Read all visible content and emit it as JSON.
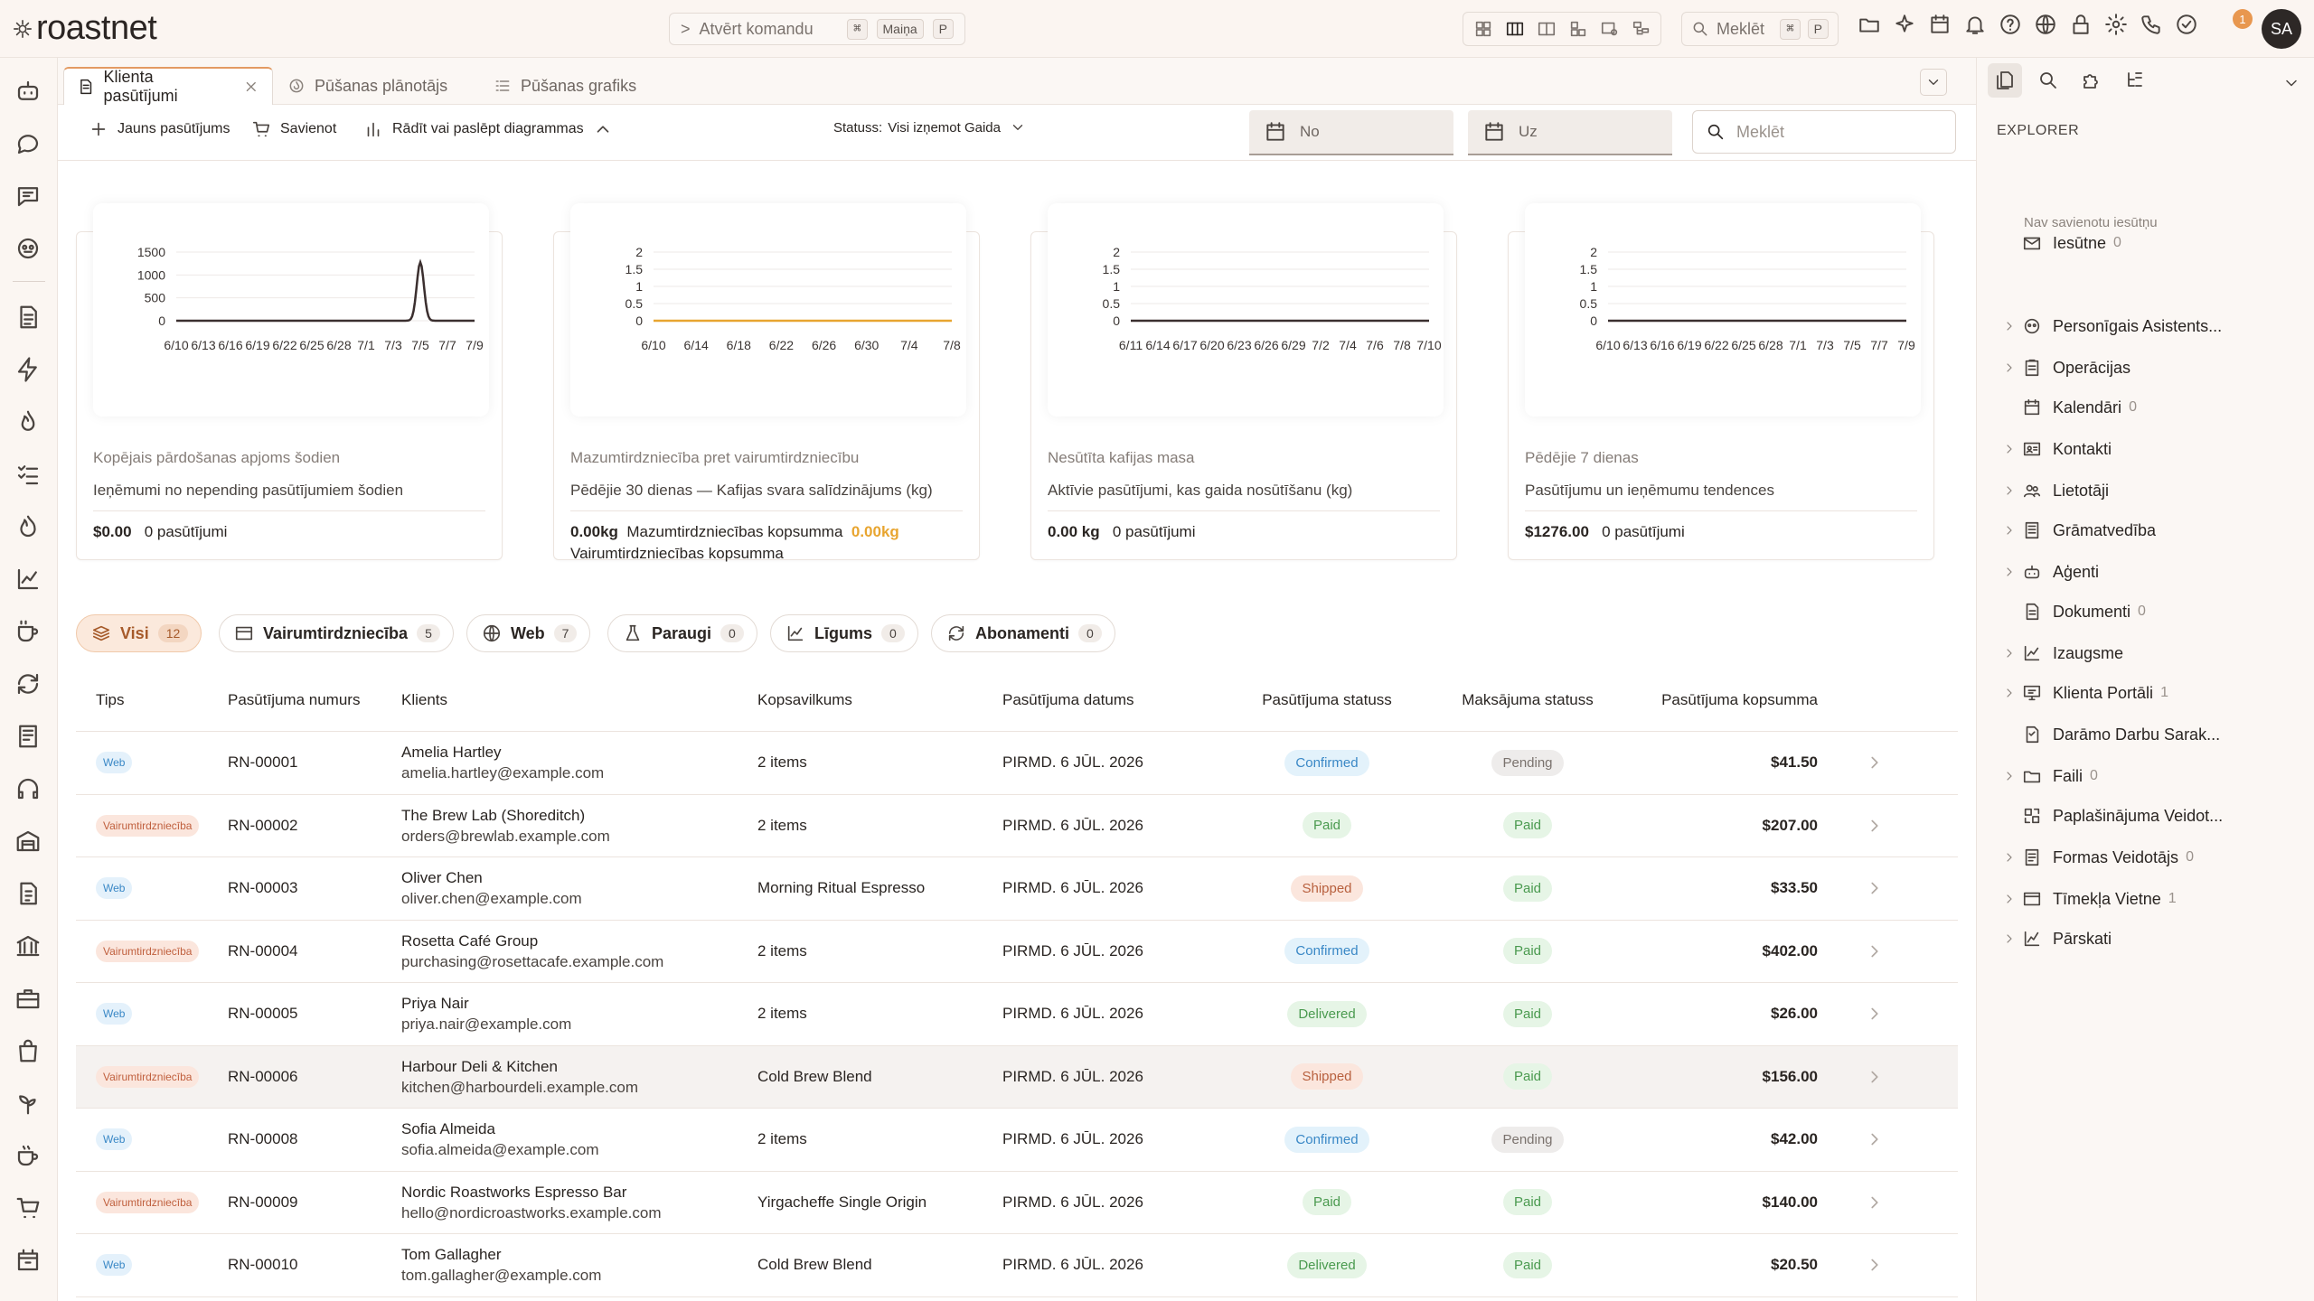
{
  "app": {
    "name": "roastnet",
    "user_initials": "SA",
    "notifications": "1"
  },
  "command": {
    "label": "Atvērt komandu",
    "key1": "⌘",
    "key2": "Maiņa",
    "key3": "P"
  },
  "global_search": {
    "label": "Meklēt",
    "key1": "⌘",
    "key2": "P"
  },
  "tabs": [
    {
      "label": "Klienta pasūtījumi"
    },
    {
      "label": "Pūšanas plānotājs"
    },
    {
      "label": "Pūšanas grafiks"
    }
  ],
  "toolbar": {
    "new_order": "Jauns pasūtījums",
    "connect": "Savienot",
    "toggle_charts": "Rādīt vai paslēpt diagrammas",
    "status_label": "Statuss:",
    "status_value": "Visi izņemot Gaida",
    "date_from": "No",
    "date_to": "Uz",
    "search_placeholder": "Meklēt"
  },
  "cards": [
    {
      "title": "Kopējais pārdošanas apjoms šodien",
      "subtitle": "Ieņēmumi no nepending pasūtījumiem šodien",
      "value": "$0.00",
      "count": "0 pasūtījumi"
    },
    {
      "title": "Mazumtirdzniecība pret vairumtirdzniecību",
      "subtitle": "Pēdējie 30 dienas — Kafijas svara salīdzinājums (kg)",
      "value": "0.00kg",
      "value_label": "Mazumtirdzniecības kopsumma",
      "value2": "0.00kg",
      "value2_label": "Vairumtirdzniecības kopsumma"
    },
    {
      "title": "Nesūtīta kafijas masa",
      "subtitle": "Aktīvie pasūtījumi, kas gaida nosūtīšanu (kg)",
      "value": "0.00 kg",
      "count": "0 pasūtījumi"
    },
    {
      "title": "Pēdējie 7 dienas",
      "subtitle": "Pasūtījumu un ieņēmumu tendences",
      "value": "$1276.00",
      "count": "0 pasūtījumi"
    }
  ],
  "chart_data": [
    {
      "type": "line",
      "x": [
        "6/10",
        "6/13",
        "6/16",
        "6/19",
        "6/22",
        "6/25",
        "6/28",
        "7/1",
        "7/3",
        "7/5",
        "7/7",
        "7/9"
      ],
      "yticks": [
        0,
        500,
        1000,
        1500
      ],
      "ylim": [
        0,
        1500
      ],
      "series": [
        {
          "color": "#3b2f2f",
          "values": [
            0,
            0,
            0,
            0,
            0,
            0,
            0,
            0,
            0,
            1276,
            0,
            0
          ]
        }
      ]
    },
    {
      "type": "line",
      "x": [
        "6/10",
        "6/14",
        "6/18",
        "6/22",
        "6/26",
        "6/30",
        "7/4",
        "7/8"
      ],
      "yticks": [
        0,
        0.5,
        1,
        1.5,
        2
      ],
      "ylim": [
        0,
        2
      ],
      "series": [
        {
          "color": "#e8a530",
          "values": [
            0,
            0,
            0,
            0,
            0,
            0,
            0,
            0
          ]
        }
      ]
    },
    {
      "type": "line",
      "x": [
        "6/11",
        "6/14",
        "6/17",
        "6/20",
        "6/23",
        "6/26",
        "6/29",
        "7/2",
        "7/4",
        "7/6",
        "7/8",
        "7/10"
      ],
      "yticks": [
        0,
        0.5,
        1,
        1.5,
        2
      ],
      "ylim": [
        0,
        2
      ],
      "series": [
        {
          "color": "#3b2f2f",
          "values": [
            0,
            0,
            0,
            0,
            0,
            0,
            0,
            0,
            0,
            0,
            0,
            0
          ]
        }
      ]
    },
    {
      "type": "line",
      "x": [
        "6/10",
        "6/13",
        "6/16",
        "6/19",
        "6/22",
        "6/25",
        "6/28",
        "7/1",
        "7/3",
        "7/5",
        "7/7",
        "7/9"
      ],
      "yticks": [
        0,
        0.5,
        1,
        1.5,
        2
      ],
      "ylim": [
        0,
        2
      ],
      "series": [
        {
          "color": "#3b2f2f",
          "values": [
            0,
            0,
            0,
            0,
            0,
            0,
            0,
            0,
            0,
            0,
            0,
            0
          ]
        }
      ]
    }
  ],
  "filters": [
    {
      "label": "Visi",
      "count": "12"
    },
    {
      "label": "Vairumtirdzniecība",
      "count": "5"
    },
    {
      "label": "Web",
      "count": "7"
    },
    {
      "label": "Paraugi",
      "count": "0"
    },
    {
      "label": "Līgums",
      "count": "0"
    },
    {
      "label": "Abonamenti",
      "count": "0"
    }
  ],
  "table": {
    "headers": [
      "Tips",
      "Pasūtījuma numurs",
      "Klients",
      "Kopsavilkums",
      "Pasūtījuma datums",
      "Pasūtījuma statuss",
      "Maksājuma statuss",
      "Pasūtījuma kopsumma"
    ],
    "rows": [
      {
        "type": "Web",
        "num": "RN-00001",
        "name": "Amelia Hartley",
        "email": "amelia.hartley@example.com",
        "summary": "2 items",
        "date": "PIRMD. 6 JŪL. 2026",
        "status": "Confirmed",
        "payment": "Pending",
        "total": "$41.50"
      },
      {
        "type": "Vairumtirdzniecība",
        "num": "RN-00002",
        "name": "The Brew Lab (Shoreditch)",
        "email": "orders@brewlab.example.com",
        "summary": "2 items",
        "date": "PIRMD. 6 JŪL. 2026",
        "status": "Paid",
        "payment": "Paid",
        "total": "$207.00"
      },
      {
        "type": "Web",
        "num": "RN-00003",
        "name": "Oliver Chen",
        "email": "oliver.chen@example.com",
        "summary": "Morning Ritual Espresso",
        "date": "PIRMD. 6 JŪL. 2026",
        "status": "Shipped",
        "payment": "Paid",
        "total": "$33.50"
      },
      {
        "type": "Vairumtirdzniecība",
        "num": "RN-00004",
        "name": "Rosetta Café Group",
        "email": "purchasing@rosettacafe.example.com",
        "summary": "2 items",
        "date": "PIRMD. 6 JŪL. 2026",
        "status": "Confirmed",
        "payment": "Paid",
        "total": "$402.00"
      },
      {
        "type": "Web",
        "num": "RN-00005",
        "name": "Priya Nair",
        "email": "priya.nair@example.com",
        "summary": "2 items",
        "date": "PIRMD. 6 JŪL. 2026",
        "status": "Delivered",
        "payment": "Paid",
        "total": "$26.00"
      },
      {
        "type": "Vairumtirdzniecība",
        "num": "RN-00006",
        "name": "Harbour Deli & Kitchen",
        "email": "kitchen@harbourdeli.example.com",
        "summary": "Cold Brew Blend",
        "date": "PIRMD. 6 JŪL. 2026",
        "status": "Shipped",
        "payment": "Paid",
        "total": "$156.00"
      },
      {
        "type": "Web",
        "num": "RN-00008",
        "name": "Sofia Almeida",
        "email": "sofia.almeida@example.com",
        "summary": "2 items",
        "date": "PIRMD. 6 JŪL. 2026",
        "status": "Confirmed",
        "payment": "Pending",
        "total": "$42.00"
      },
      {
        "type": "Vairumtirdzniecība",
        "num": "RN-00009",
        "name": "Nordic Roastworks Espresso Bar",
        "email": "hello@nordicroastworks.example.com",
        "summary": "Yirgacheffe Single Origin",
        "date": "PIRMD. 6 JŪL. 2026",
        "status": "Paid",
        "payment": "Paid",
        "total": "$140.00"
      },
      {
        "type": "Web",
        "num": "RN-00010",
        "name": "Tom Gallagher",
        "email": "tom.gallagher@example.com",
        "summary": "Cold Brew Blend",
        "date": "PIRMD. 6 JŪL. 2026",
        "status": "Delivered",
        "payment": "Paid",
        "total": "$20.50"
      }
    ]
  },
  "explorer": {
    "title": "EXPLORER",
    "no_inbox": "Nav savienotu iesūtņu",
    "items": [
      {
        "label": "Iesūtne",
        "count": "0",
        "chev": false,
        "icon": "mail-icon"
      },
      {
        "label": "Personīgais Asistents...",
        "count": "",
        "chev": true,
        "icon": "assistant-icon"
      },
      {
        "label": "Operācijas",
        "count": "",
        "chev": true,
        "icon": "clipboard-icon"
      },
      {
        "label": "Kalendāri",
        "count": "0",
        "chev": false,
        "icon": "calendar-icon"
      },
      {
        "label": "Kontakti",
        "count": "",
        "chev": true,
        "icon": "contact-card-icon"
      },
      {
        "label": "Lietotāji",
        "count": "",
        "chev": true,
        "icon": "users-icon"
      },
      {
        "label": "Grāmatvedība",
        "count": "",
        "chev": true,
        "icon": "ledger-icon"
      },
      {
        "label": "Aģenti",
        "count": "",
        "chev": true,
        "icon": "robot-icon"
      },
      {
        "label": "Dokumenti",
        "count": "0",
        "chev": false,
        "icon": "document-icon"
      },
      {
        "label": "Izaugsme",
        "count": "",
        "chev": true,
        "icon": "growth-chart-icon"
      },
      {
        "label": "Klienta Portāli",
        "count": "1",
        "chev": true,
        "icon": "portal-icon"
      },
      {
        "label": "Darāmo Darbu Sarak...",
        "count": "",
        "chev": false,
        "icon": "todo-list-icon"
      },
      {
        "label": "Faili",
        "count": "0",
        "chev": true,
        "icon": "folder-icon"
      },
      {
        "label": "Paplašinājuma Veidot...",
        "count": "",
        "chev": false,
        "icon": "extension-icon"
      },
      {
        "label": "Formas Veidotājs",
        "count": "0",
        "chev": true,
        "icon": "form-icon"
      },
      {
        "label": "Tīmekļa Vietne",
        "count": "1",
        "chev": true,
        "icon": "browser-icon"
      },
      {
        "label": "Pārskati",
        "count": "",
        "chev": true,
        "icon": "reports-icon"
      }
    ]
  }
}
